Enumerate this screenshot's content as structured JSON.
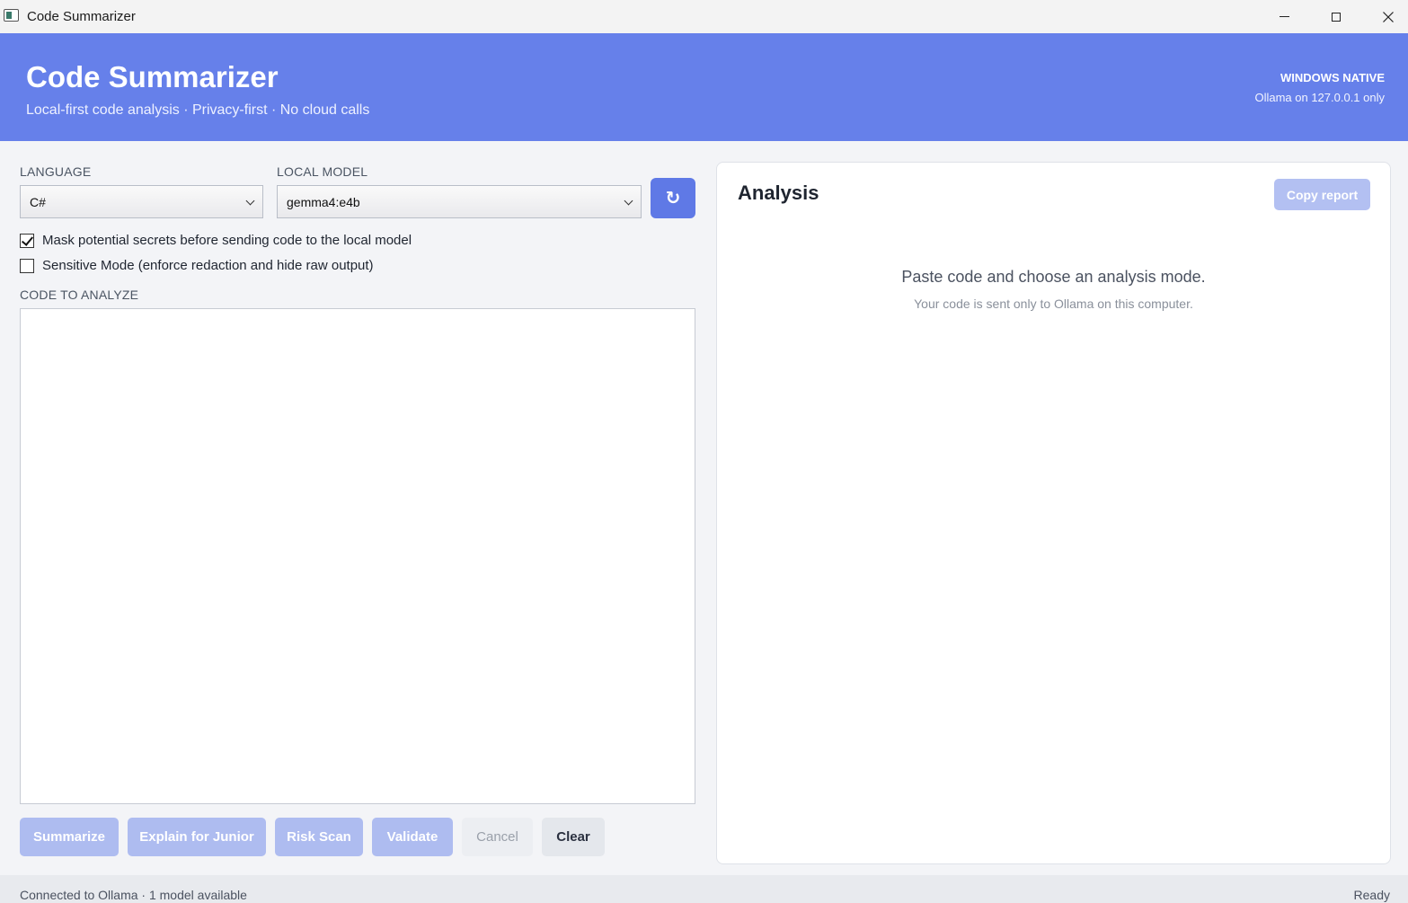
{
  "window": {
    "title": "Code Summarizer"
  },
  "header": {
    "title": "Code Summarizer",
    "subtitle": "Local-first code analysis · Privacy-first · No cloud calls",
    "badge": "WINDOWS NATIVE",
    "badge_sub": "Ollama on 127.0.0.1 only"
  },
  "controls": {
    "language_label": "LANGUAGE",
    "language_value": "C#",
    "model_label": "LOCAL MODEL",
    "model_value": "gemma4:e4b",
    "refresh_glyph": "↻",
    "mask_secrets_label": "Mask potential secrets before sending code to the local model",
    "mask_secrets_checked": true,
    "sensitive_mode_label": "Sensitive Mode (enforce redaction and hide raw output)",
    "sensitive_mode_checked": false,
    "code_label": "CODE TO ANALYZE",
    "code_value": ""
  },
  "actions": {
    "summarize": "Summarize",
    "explain": "Explain for Junior",
    "risk_scan": "Risk Scan",
    "validate": "Validate",
    "cancel": "Cancel",
    "clear": "Clear"
  },
  "analysis": {
    "title": "Analysis",
    "copy_report": "Copy report",
    "empty_title": "Paste code and choose an analysis mode.",
    "empty_sub": "Your code is sent only to Ollama on this computer."
  },
  "status": {
    "left": "Connected to Ollama · 1 model available",
    "right": "Ready"
  },
  "colors": {
    "header": "#6680ea",
    "accent": "#5f79e6",
    "disabled_button": "#aebcf0"
  }
}
